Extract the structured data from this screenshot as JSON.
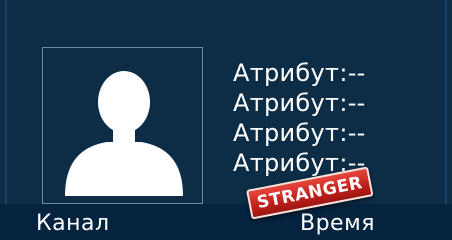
{
  "attributes": [
    {
      "label": "Атрибут:",
      "value": "--"
    },
    {
      "label": "Атрибут:",
      "value": "--"
    },
    {
      "label": "Атрибут:",
      "value": "--"
    },
    {
      "label": "Атрибут:",
      "value": "--"
    }
  ],
  "stamp": {
    "text": "STRANGER"
  },
  "footer": {
    "channel_label": "Канал",
    "time_label": "Время"
  },
  "colors": {
    "background": "#0d2d47",
    "stamp_red": "#c0211c"
  },
  "icons": {
    "photo_placeholder": "person-silhouette-icon"
  }
}
